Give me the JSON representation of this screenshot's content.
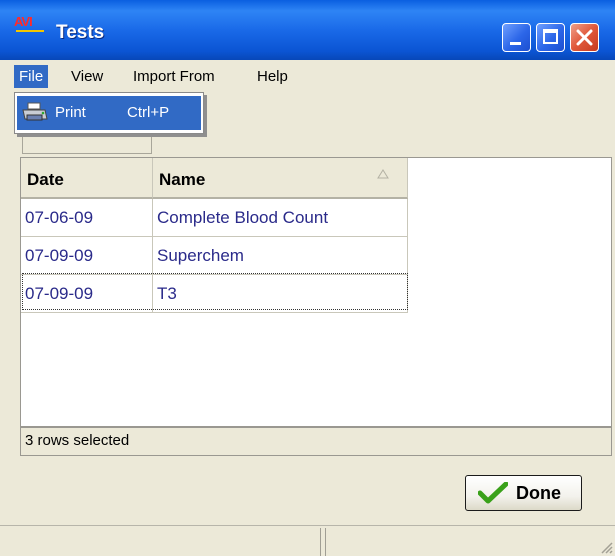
{
  "window": {
    "title": "Tests",
    "logo_text": "AVI"
  },
  "menu": {
    "items": [
      "File",
      "View",
      "Import From",
      "Help"
    ],
    "active": "File"
  },
  "file_menu": {
    "items": [
      {
        "label": "Print",
        "shortcut": "Ctrl+P",
        "icon": "printer-icon"
      }
    ]
  },
  "table": {
    "columns": [
      "Date",
      "Name"
    ],
    "sort_column": "Name",
    "sort_direction": "ascending",
    "rows": [
      {
        "date": "07-06-09",
        "name": "Complete Blood Count"
      },
      {
        "date": "07-09-09",
        "name": "Superchem"
      },
      {
        "date": "07-09-09",
        "name": "T3"
      }
    ]
  },
  "status": {
    "text": "3 rows selected"
  },
  "buttons": {
    "done_label": "Done"
  },
  "colors": {
    "titlebar": "#0b55d4",
    "selection": "#316ac5",
    "cell_text": "#2a2a8a",
    "done_check": "#3aa11a",
    "close_button": "#e0583a"
  }
}
